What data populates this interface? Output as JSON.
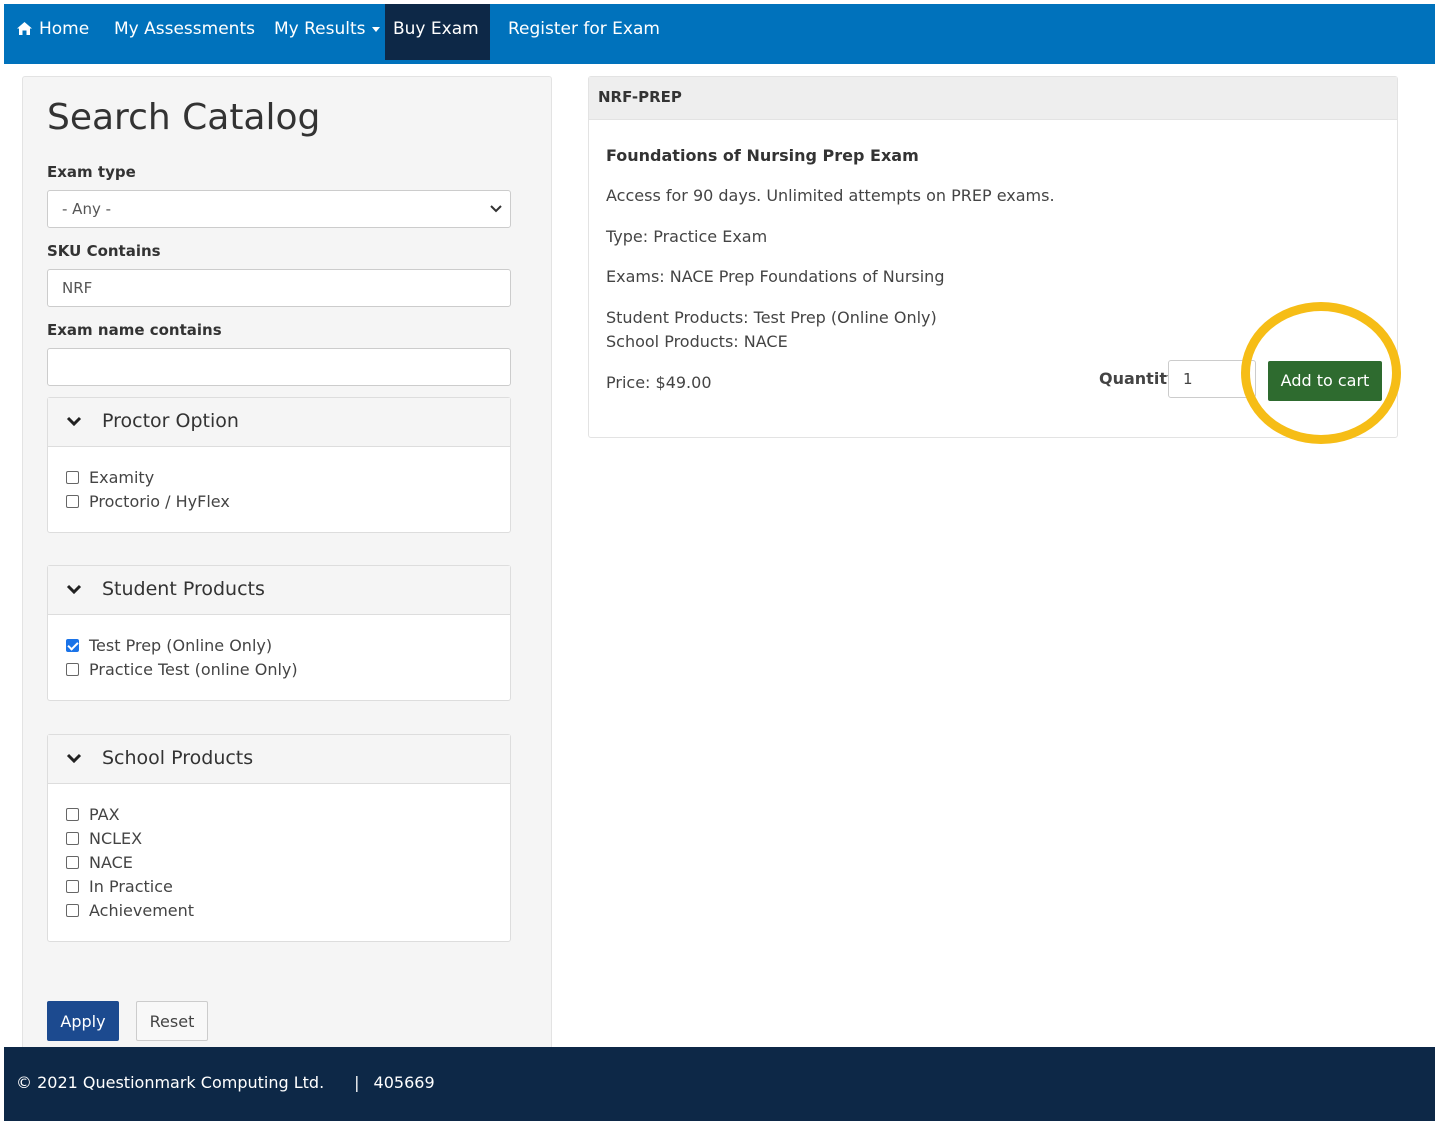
{
  "nav": {
    "home": "Home",
    "assessments": "My Assessments",
    "results": "My Results",
    "buy": "Buy Exam",
    "register": "Register for Exam"
  },
  "catalog": {
    "title": "Search Catalog",
    "exam_type_label": "Exam type",
    "exam_type_value": "- Any -",
    "sku_label": "SKU Contains",
    "sku_value": "NRF",
    "name_label": "Exam name contains",
    "name_value": "",
    "groups": [
      {
        "title": "Proctor Option",
        "options": [
          {
            "label": "Examity",
            "checked": false
          },
          {
            "label": "Proctorio / HyFlex",
            "checked": false
          }
        ]
      },
      {
        "title": "Student Products",
        "options": [
          {
            "label": "Test Prep (Online Only)",
            "checked": true
          },
          {
            "label": "Practice Test (online Only)",
            "checked": false
          }
        ]
      },
      {
        "title": "School Products",
        "options": [
          {
            "label": "PAX",
            "checked": false
          },
          {
            "label": "NCLEX",
            "checked": false
          },
          {
            "label": "NACE",
            "checked": false
          },
          {
            "label": "In Practice",
            "checked": false
          },
          {
            "label": "Achievement",
            "checked": false
          }
        ]
      }
    ],
    "apply": "Apply",
    "reset": "Reset"
  },
  "product": {
    "sku": "NRF-PREP",
    "name": "Foundations of Nursing Prep Exam",
    "access": "Access for 90 days. Unlimited attempts on PREP exams.",
    "type": "Type: Practice Exam",
    "exams": "Exams: NACE Prep Foundations of Nursing",
    "student_products": "Student Products: Test Prep (Online Only)",
    "school_products": "School Products: NACE",
    "price": "Price: $49.00",
    "quantity_label": "Quantity",
    "quantity_value": "1",
    "add_to_cart": "Add to cart",
    "highlight_color": "#f6bd16"
  },
  "footer": {
    "copyright": "© 2021 Questionmark Computing Ltd.",
    "separator": "|",
    "code": "405669"
  }
}
